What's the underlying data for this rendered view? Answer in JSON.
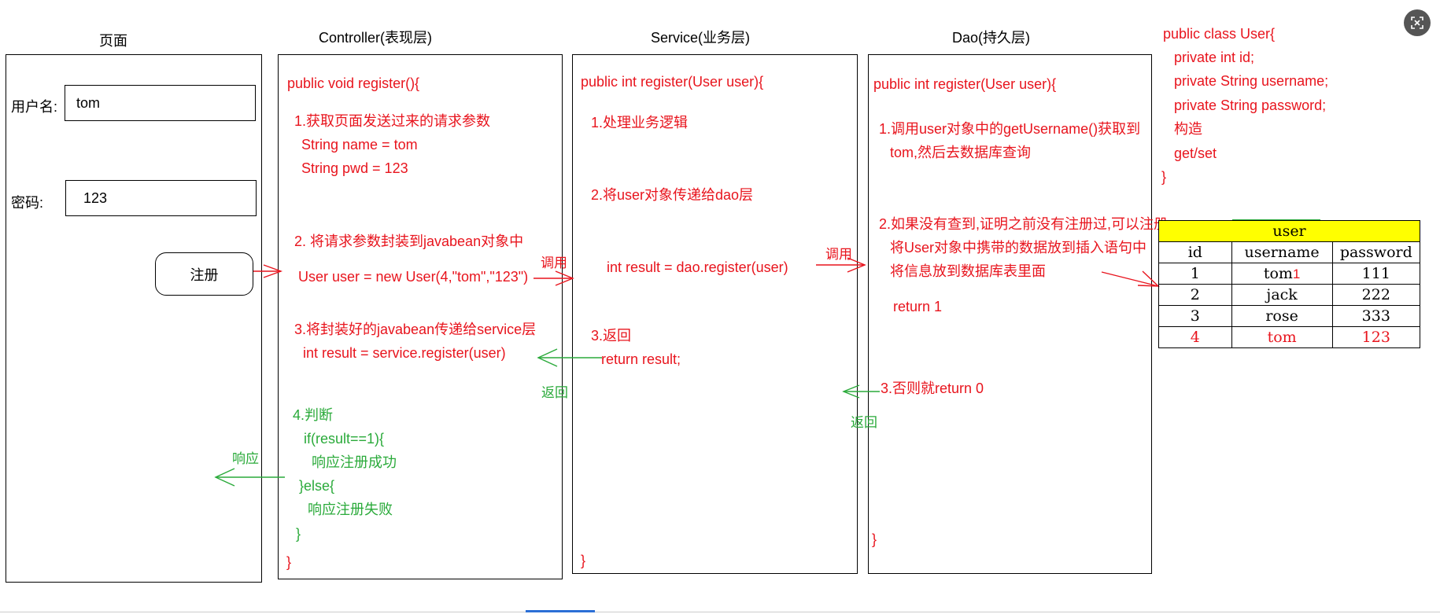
{
  "columns": {
    "page": "页面",
    "controller": "Controller(表现层)",
    "service": "Service(业务层)",
    "dao": "Dao(持久层)"
  },
  "page_form": {
    "username_label": "用户名:",
    "username_value": "tom",
    "password_label": "密码:",
    "password_value": "123",
    "register_button": "注册"
  },
  "controller": {
    "l1": "public void register(){",
    "l2": "1.获取页面发送过来的请求参数",
    "l3": "String name = tom",
    "l4": "String pwd = 123",
    "l5": "2. 将请求参数封装到javabean对象中",
    "l6": "User user = new User(4,\"tom\",\"123\")",
    "l7": "3.将封装好的javabean传递给service层",
    "l8": "int result = service.register(user)",
    "l9": "4.判断",
    "l10": "if(result==1){",
    "l11": "响应注册成功",
    "l12": "}else{",
    "l13": "响应注册失败",
    "l14": "}",
    "l15": "}"
  },
  "service": {
    "l1": "public int register(User user){",
    "l2": "1.处理业务逻辑",
    "l3": "2.将user对象传递给dao层",
    "l4": "int result = dao.register(user)",
    "l5": "3.返回",
    "l6": "return result;",
    "l7": "}"
  },
  "dao": {
    "l1": "public int register(User user){",
    "l2": "1.调用user对象中的getUsername()获取到",
    "l3": "tom,然后去数据库查询",
    "l4": "2.如果没有查到,证明之前没有注册过,可以注册",
    "l5": "将User对象中携带的数据放到插入语句中",
    "l6": "将信息放到数据库表里面",
    "l7": "return 1",
    "l8": "3.否则就return 0",
    "l9": "}"
  },
  "user_class": {
    "l1": "public class User{",
    "l2": "private int id;",
    "l3": "private String username;",
    "l4": "private String password;",
    "l5": "构造",
    "l6": "get/set",
    "l7": "}"
  },
  "arrows": {
    "call1": "调用",
    "call2": "调用",
    "return1": "返回",
    "return2": "返回",
    "response": "响应"
  },
  "user_table": {
    "title": "user",
    "headers": [
      "id",
      "username",
      "password"
    ],
    "rows": [
      [
        "1",
        "tom",
        "111"
      ],
      [
        "2",
        "jack",
        "222"
      ],
      [
        "3",
        "rose",
        "333"
      ],
      [
        "4",
        "tom",
        "123"
      ]
    ],
    "row1_marker": "1"
  },
  "colors": {
    "red": "#e8141d",
    "green": "#2aaa3a",
    "yellow": "#ffff00"
  }
}
